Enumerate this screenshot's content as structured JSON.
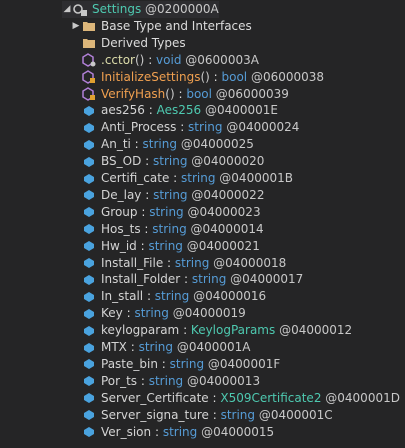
{
  "root": {
    "name": "Settings",
    "token": "@0200000A"
  },
  "folders": [
    {
      "label": "Base Type and Interfaces",
      "expander": "▶"
    },
    {
      "label": "Derived Types",
      "expander": ""
    }
  ],
  "methods": [
    {
      "name": ".cctor",
      "sig": "()",
      "ret": "void",
      "token": "@0600003A",
      "style": "static"
    },
    {
      "name": "InitializeSettings",
      "sig": "()",
      "ret": "bool",
      "token": "@06000038",
      "style": "private"
    },
    {
      "name": "VerifyHash",
      "sig": "()",
      "ret": "bool",
      "token": "@06000039",
      "style": "private"
    }
  ],
  "fields": [
    {
      "name": "aes256",
      "type": "Aes256",
      "token": "@0400001E",
      "custom": true
    },
    {
      "name": "Anti_Process",
      "type": "string",
      "token": "@04000024"
    },
    {
      "name": "An_ti",
      "type": "string",
      "token": "@04000025"
    },
    {
      "name": "BS_OD",
      "type": "string",
      "token": "@04000020"
    },
    {
      "name": "Certifi_cate",
      "type": "string",
      "token": "@0400001B"
    },
    {
      "name": "De_lay",
      "type": "string",
      "token": "@04000022"
    },
    {
      "name": "Group",
      "type": "string",
      "token": "@04000023"
    },
    {
      "name": "Hos_ts",
      "type": "string",
      "token": "@04000014"
    },
    {
      "name": "Hw_id",
      "type": "string",
      "token": "@04000021"
    },
    {
      "name": "Install_File",
      "type": "string",
      "token": "@04000018"
    },
    {
      "name": "Install_Folder",
      "type": "string",
      "token": "@04000017"
    },
    {
      "name": "In_stall",
      "type": "string",
      "token": "@04000016"
    },
    {
      "name": "Key",
      "type": "string",
      "token": "@04000019"
    },
    {
      "name": "keylogparam",
      "type": "KeylogParams",
      "token": "@04000012",
      "custom": true
    },
    {
      "name": "MTX",
      "type": "string",
      "token": "@0400001A"
    },
    {
      "name": "Paste_bin",
      "type": "string",
      "token": "@0400001F"
    },
    {
      "name": "Por_ts",
      "type": "string",
      "token": "@04000013"
    },
    {
      "name": "Server_Certificate",
      "type": "X509Certificate2",
      "token": "@0400001D",
      "custom": true
    },
    {
      "name": "Server_signa_ture",
      "type": "string",
      "token": "@0400001C"
    },
    {
      "name": "Ver_sion",
      "type": "string",
      "token": "@04000015"
    }
  ],
  "colors": {
    "background": "#252526",
    "type": "#4ec9b0",
    "keyword": "#569cd6",
    "field_icon": "#4aa3df"
  }
}
